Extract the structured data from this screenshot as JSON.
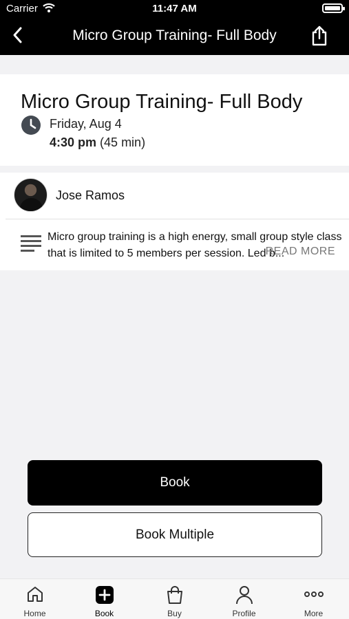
{
  "status_bar": {
    "carrier": "Carrier",
    "time": "11:47 AM"
  },
  "nav": {
    "title": "Micro Group Training- Full Body"
  },
  "class": {
    "title": "Micro Group Training- Full Body",
    "date": "Friday, Aug 4",
    "start_time": "4:30 pm",
    "duration": "(45 min)"
  },
  "instructor": {
    "name": "Jose Ramos"
  },
  "description": {
    "text": "Micro group training is a high energy, small group style class that is limited to 5 members per session. Led b...",
    "read_more": "READ MORE"
  },
  "buttons": {
    "book": "Book",
    "book_multiple": "Book Multiple"
  },
  "tabbar": {
    "items": [
      {
        "label": "Home",
        "icon": "home-icon"
      },
      {
        "label": "Book",
        "icon": "plus-square-icon"
      },
      {
        "label": "Buy",
        "icon": "shopping-bag-icon"
      },
      {
        "label": "Profile",
        "icon": "person-icon"
      },
      {
        "label": "More",
        "icon": "ellipsis-icon"
      }
    ]
  },
  "colors": {
    "header_bg": "#000000",
    "page_bg": "#f2f2f4",
    "primary_button": "#000000"
  }
}
